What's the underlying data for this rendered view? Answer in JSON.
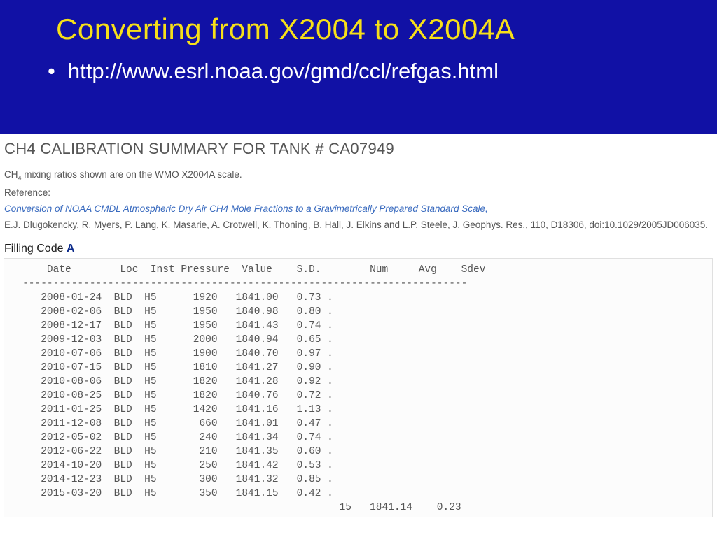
{
  "slide": {
    "title": "Converting from X2004 to X2004A",
    "bullet": "http://www.esrl.noaa.gov/gmd/ccl/refgas.html"
  },
  "content": {
    "summary_title": "CH4 CALIBRATION SUMMARY FOR TANK # CA07949",
    "molecule_prefix": "CH",
    "molecule_sub": "4",
    "mixing_text": " mixing ratios shown are on the WMO X2004A scale.",
    "reference_label": "Reference:",
    "reference_link": "Conversion of NOAA CMDL Atmospheric Dry Air CH4 Mole Fractions to a Gravimetrically Prepared Standard Scale,",
    "authors": "E.J. Dlugokencky, R. Myers, P. Lang, K. Masarie, A. Crotwell, K. Thoning, B. Hall, J. Elkins and L.P. Steele, J. Geophys. Res., 110, D18306, doi:10.1029/2005JD006035.",
    "filling_label": "Filling Code ",
    "filling_code": "A",
    "table": {
      "columns": [
        "Date",
        "Loc",
        "Inst",
        "Pressure",
        "Value",
        "S.D.",
        "Num",
        "Avg",
        "Sdev"
      ],
      "rows": [
        {
          "date": "2008-01-24",
          "loc": "BLD",
          "inst": "H5",
          "pressure": "1920",
          "value": "1841.00",
          "sd": "0.73"
        },
        {
          "date": "2008-02-06",
          "loc": "BLD",
          "inst": "H5",
          "pressure": "1950",
          "value": "1840.98",
          "sd": "0.80"
        },
        {
          "date": "2008-12-17",
          "loc": "BLD",
          "inst": "H5",
          "pressure": "1950",
          "value": "1841.43",
          "sd": "0.74"
        },
        {
          "date": "2009-12-03",
          "loc": "BLD",
          "inst": "H5",
          "pressure": "2000",
          "value": "1840.94",
          "sd": "0.65"
        },
        {
          "date": "2010-07-06",
          "loc": "BLD",
          "inst": "H5",
          "pressure": "1900",
          "value": "1840.70",
          "sd": "0.97"
        },
        {
          "date": "2010-07-15",
          "loc": "BLD",
          "inst": "H5",
          "pressure": "1810",
          "value": "1841.27",
          "sd": "0.90"
        },
        {
          "date": "2010-08-06",
          "loc": "BLD",
          "inst": "H5",
          "pressure": "1820",
          "value": "1841.28",
          "sd": "0.92"
        },
        {
          "date": "2010-08-25",
          "loc": "BLD",
          "inst": "H5",
          "pressure": "1820",
          "value": "1840.76",
          "sd": "0.72"
        },
        {
          "date": "2011-01-25",
          "loc": "BLD",
          "inst": "H5",
          "pressure": "1420",
          "value": "1841.16",
          "sd": "1.13"
        },
        {
          "date": "2011-12-08",
          "loc": "BLD",
          "inst": "H5",
          "pressure": "660",
          "value": "1841.01",
          "sd": "0.47"
        },
        {
          "date": "2012-05-02",
          "loc": "BLD",
          "inst": "H5",
          "pressure": "240",
          "value": "1841.34",
          "sd": "0.74"
        },
        {
          "date": "2012-06-22",
          "loc": "BLD",
          "inst": "H5",
          "pressure": "210",
          "value": "1841.35",
          "sd": "0.60"
        },
        {
          "date": "2014-10-20",
          "loc": "BLD",
          "inst": "H5",
          "pressure": "250",
          "value": "1841.42",
          "sd": "0.53"
        },
        {
          "date": "2014-12-23",
          "loc": "BLD",
          "inst": "H5",
          "pressure": "300",
          "value": "1841.32",
          "sd": "0.85"
        },
        {
          "date": "2015-03-20",
          "loc": "BLD",
          "inst": "H5",
          "pressure": "350",
          "value": "1841.15",
          "sd": "0.42"
        }
      ],
      "summary": {
        "num": "15",
        "avg": "1841.14",
        "sdev": "0.23"
      }
    }
  },
  "chart_data": {
    "type": "table",
    "title": "CH4 Calibration Summary for Tank # CA07949",
    "columns": [
      "Date",
      "Loc",
      "Inst",
      "Pressure",
      "Value",
      "S.D."
    ],
    "rows": [
      [
        "2008-01-24",
        "BLD",
        "H5",
        1920,
        1841.0,
        0.73
      ],
      [
        "2008-02-06",
        "BLD",
        "H5",
        1950,
        1840.98,
        0.8
      ],
      [
        "2008-12-17",
        "BLD",
        "H5",
        1950,
        1841.43,
        0.74
      ],
      [
        "2009-12-03",
        "BLD",
        "H5",
        2000,
        1840.94,
        0.65
      ],
      [
        "2010-07-06",
        "BLD",
        "H5",
        1900,
        1840.7,
        0.97
      ],
      [
        "2010-07-15",
        "BLD",
        "H5",
        1810,
        1841.27,
        0.9
      ],
      [
        "2010-08-06",
        "BLD",
        "H5",
        1820,
        1841.28,
        0.92
      ],
      [
        "2010-08-25",
        "BLD",
        "H5",
        1820,
        1840.76,
        0.72
      ],
      [
        "2011-01-25",
        "BLD",
        "H5",
        1420,
        1841.16,
        1.13
      ],
      [
        "2011-12-08",
        "BLD",
        "H5",
        660,
        1841.01,
        0.47
      ],
      [
        "2012-05-02",
        "BLD",
        "H5",
        240,
        1841.34,
        0.74
      ],
      [
        "2012-06-22",
        "BLD",
        "H5",
        210,
        1841.35,
        0.6
      ],
      [
        "2014-10-20",
        "BLD",
        "H5",
        250,
        1841.42,
        0.53
      ],
      [
        "2014-12-23",
        "BLD",
        "H5",
        300,
        1841.32,
        0.85
      ],
      [
        "2015-03-20",
        "BLD",
        "H5",
        350,
        1841.15,
        0.42
      ]
    ],
    "summary": {
      "num": 15,
      "avg": 1841.14,
      "sdev": 0.23
    }
  }
}
